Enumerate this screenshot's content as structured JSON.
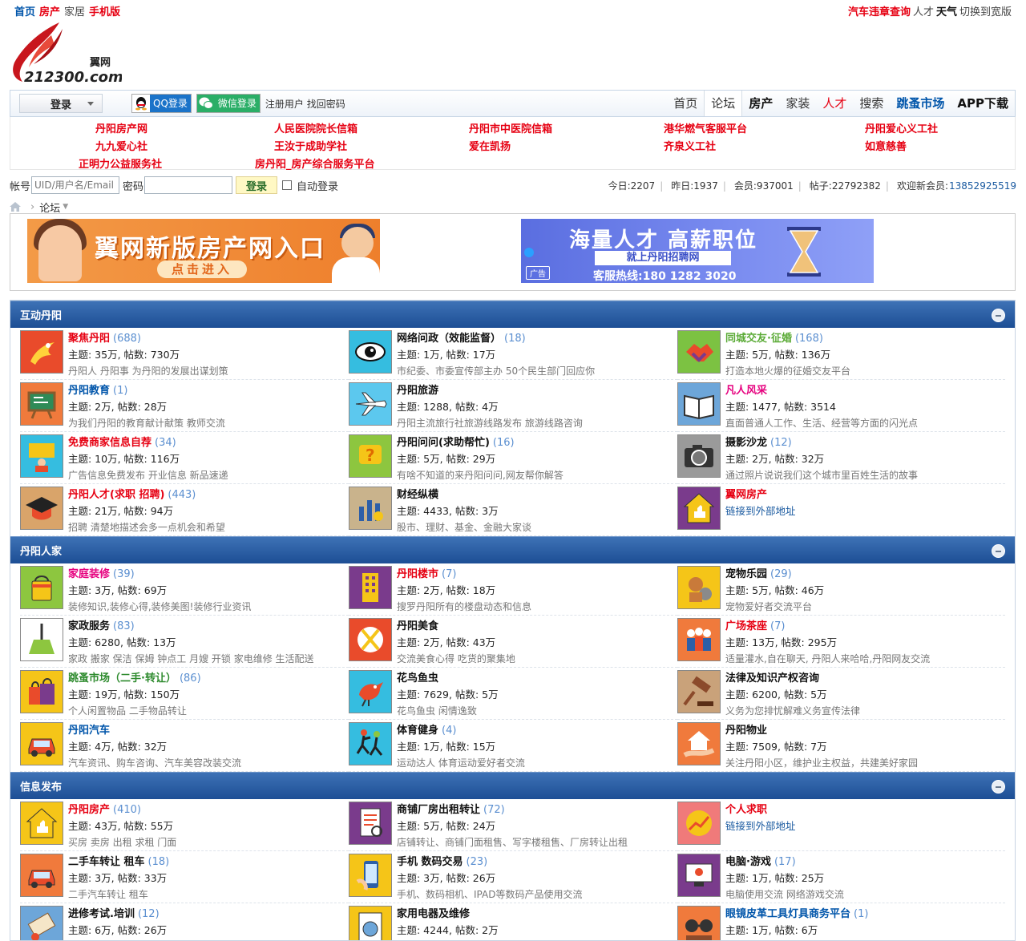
{
  "topbar": {
    "left": [
      {
        "label": "首页",
        "style": "blue"
      },
      {
        "label": "房产",
        "style": "red"
      },
      {
        "label": "家居",
        "style": "gray"
      },
      {
        "label": "手机版",
        "style": "red"
      }
    ],
    "right": [
      {
        "label": "汽车违章查询",
        "style": "red"
      },
      {
        "label": "人才",
        "style": "gray"
      },
      {
        "label": "天气",
        "style": "blk"
      },
      {
        "label": "切换到宽版",
        "style": "gray"
      }
    ]
  },
  "logo": {
    "cn": "翼网",
    "en": "212300.com"
  },
  "nav": {
    "login_label": "登录",
    "qq_label": "QQ登录",
    "wx_label": "微信登录",
    "register": "注册用户",
    "forgot": "找回密码",
    "items": [
      {
        "label": "首页",
        "style": ""
      },
      {
        "label": "论坛",
        "style": "act"
      },
      {
        "label": "房产",
        "style": "bk"
      },
      {
        "label": "家装",
        "style": ""
      },
      {
        "label": "人才",
        "style": "rd"
      },
      {
        "label": "搜索",
        "style": ""
      },
      {
        "label": "跳蚤市场",
        "style": "bl"
      },
      {
        "label": "APP下载",
        "style": "bk"
      }
    ]
  },
  "links": [
    "丹阳房产网",
    "人民医院院长信箱",
    "丹阳市中医院信箱",
    "港华燃气客服平台",
    "丹阳爱心义工社",
    "九九爱心社",
    "王汝于成助学社",
    "爱在凯扬",
    "齐泉义工社",
    "如意慈善",
    "正明力公益服务社",
    "房丹阳_房产综合服务平台"
  ],
  "login": {
    "account_label": "帐号",
    "account_placeholder": "UID/用户名/Email",
    "password_label": "密码",
    "submit": "登录",
    "auto": "自动登录"
  },
  "stats": {
    "today": "今日:2207",
    "yesterday": "昨日:1937",
    "members": "会员:937001",
    "posts": "帖子:22792382",
    "welcome": "欢迎新会员:",
    "newest": "13852925519"
  },
  "crumb": {
    "label": "论坛"
  },
  "banners": {
    "b1_title": "翼网新版房产网入口",
    "b1_btn": "点击进入",
    "b2_title": "海量人才 高薪职位",
    "b2_sub": "就上丹阳招聘网",
    "b2_phone": "客服热线:180 1282 3020",
    "b2_ad": "广告"
  },
  "categories": [
    {
      "name": "互动丹阳",
      "forums": [
        {
          "title": "聚焦丹阳",
          "count": "(688)",
          "style": "red",
          "stats": "主题: 35万, 帖数: 730万",
          "desc": "丹阳人 丹阳事 为丹阳的发展出谋划策",
          "icon": "phoenix-icon",
          "bg": "#e94b2b"
        },
        {
          "title": "网络问政（效能监督）",
          "count": "(18)",
          "style": "",
          "stats": "主题: 1万, 帖数: 17万",
          "desc": "市纪委、市委宣传部主办 50个民生部门回应你",
          "icon": "eye-icon",
          "bg": "#35bde0"
        },
        {
          "title": "同城交友·征婚",
          "count": "(168)",
          "style": "lgr",
          "stats": "主题: 5万, 帖数: 136万",
          "desc": "打造本地火爆的征婚交友平台",
          "icon": "handshake-icon",
          "bg": "#7cc242"
        },
        {
          "title": "丹阳教育",
          "count": "(1)",
          "style": "blu",
          "stats": "主题: 2万, 帖数: 28万",
          "desc": "为我们丹阳的教育献计献策 教师交流",
          "icon": "blackboard-icon",
          "bg": "#f07a3c"
        },
        {
          "title": "丹阳旅游",
          "count": "",
          "style": "",
          "stats": "主题: 1288, 帖数: 4万",
          "desc": "丹阳主流旅行社旅游线路发布 旅游线路咨询",
          "icon": "airplane-icon",
          "bg": "#5cc8ee"
        },
        {
          "title": "凡人风采",
          "count": "",
          "style": "pnk",
          "stats": "主题: 1477, 帖数: 3514",
          "desc": "直面普通人工作、生活、经营等方面的闪光点",
          "icon": "book-icon",
          "bg": "#6da6d9"
        },
        {
          "title": "免费商家信息自荐",
          "count": "(34)",
          "style": "red",
          "stats": "主题: 10万, 帖数: 116万",
          "desc": "广告信息免费发布 开业信息 新品速递",
          "icon": "presenter-icon",
          "bg": "#35bde0"
        },
        {
          "title": "丹阳问问(求助帮忙)",
          "count": "(16)",
          "style": "",
          "stats": "主题: 5万, 帖数: 29万",
          "desc": "有啥不知道的来丹阳问问,网友帮你解答",
          "icon": "question-icon",
          "bg": "#8dc63f"
        },
        {
          "title": "摄影沙龙",
          "count": "(12)",
          "style": "",
          "stats": "主题: 2万, 帖数: 32万",
          "desc": "通过照片说说我们这个城市里百姓生活的故事",
          "icon": "camera-icon",
          "bg": "#9a9a9a"
        },
        {
          "title": "丹阳人才(求职 招聘)",
          "count": "(443)",
          "style": "red",
          "stats": "主题: 21万, 帖数: 94万",
          "desc": "招聘 清楚地描述会多一点机会和希望",
          "icon": "graduation-cap-icon",
          "bg": "#d9a46a"
        },
        {
          "title": "财经纵横",
          "count": "",
          "style": "",
          "stats": "主题: 4433, 帖数: 3万",
          "desc": "股市、理财、基金、金融大家谈",
          "icon": "chart-icon",
          "bg": "#c9b38c"
        },
        {
          "title": "翼网房产",
          "count": "",
          "style": "red",
          "stats": "",
          "desc": "",
          "ext": "链接到外部地址",
          "icon": "house-like-icon",
          "bg": "#7a3b8c"
        }
      ]
    },
    {
      "name": "丹阳人家",
      "forums": [
        {
          "title": "家庭装修",
          "count": "(39)",
          "style": "pnk",
          "stats": "主题: 3万, 帖数: 69万",
          "desc": "装修知识,装修心得,装修美图!装修行业资讯",
          "icon": "paint-bucket-icon",
          "bg": "#8dc63f"
        },
        {
          "title": "丹阳楼市",
          "count": "(7)",
          "style": "red",
          "stats": "主题: 2万, 帖数: 18万",
          "desc": "搜罗丹阳所有的楼盘动态和信息",
          "icon": "building-icon",
          "bg": "#7a3b8c"
        },
        {
          "title": "宠物乐园",
          "count": "(29)",
          "style": "",
          "stats": "主题: 5万, 帖数: 46万",
          "desc": "宠物爱好者交流平台",
          "icon": "pet-icon",
          "bg": "#f5c518"
        },
        {
          "title": "家政服务",
          "count": "(83)",
          "style": "",
          "stats": "主题: 6280, 帖数: 13万",
          "desc": "家政 搬家 保洁 保姆 钟点工 月嫂 开锁 家电维修 生活配送",
          "icon": "broom-icon",
          "bg": "#ffffff"
        },
        {
          "title": "丹阳美食",
          "count": "",
          "style": "",
          "stats": "主题: 2万, 帖数: 43万",
          "desc": "交流美食心得 吃货的聚集地",
          "icon": "cutlery-icon",
          "bg": "#e94b2b"
        },
        {
          "title": "广场茶座",
          "count": "(7)",
          "style": "red",
          "stats": "主题: 13万, 帖数: 295万",
          "desc": "适量灌水,自在聊天, 丹阳人来哈哈,丹阳网友交流",
          "icon": "people-icon",
          "bg": "#f07a3c"
        },
        {
          "title": "跳蚤市场（二手·转让）",
          "count": "(86)",
          "style": "grn",
          "stats": "主题: 19万, 帖数: 150万",
          "desc": "个人闲置物品 二手物品转让",
          "icon": "shopping-bags-icon",
          "bg": "#f5c518"
        },
        {
          "title": "花鸟鱼虫",
          "count": "",
          "style": "",
          "stats": "主题: 7629, 帖数: 5万",
          "desc": "花鸟鱼虫    闲情逸致",
          "icon": "bird-icon",
          "bg": "#35bde0"
        },
        {
          "title": "法律及知识产权咨询",
          "count": "",
          "style": "",
          "stats": "主题: 6200, 帖数: 5万",
          "desc": "义务为您排忧解难义务宣传法律",
          "icon": "gavel-icon",
          "bg": "#c9a27a"
        },
        {
          "title": "丹阳汽车",
          "count": "",
          "style": "blu",
          "stats": "主题: 4万, 帖数: 32万",
          "desc": "汽车资讯、购车咨询、汽车美容改装交流",
          "icon": "car-icon",
          "bg": "#f5c518"
        },
        {
          "title": "体育健身",
          "count": "(4)",
          "style": "",
          "stats": "主题: 1万, 帖数: 15万",
          "desc": "运动达人 体育运动爱好者交流",
          "icon": "runners-icon",
          "bg": "#35bde0"
        },
        {
          "title": "丹阳物业",
          "count": "",
          "style": "",
          "stats": "主题: 7509, 帖数: 7万",
          "desc": "关注丹阳小区，维护业主权益，共建美好家园",
          "icon": "house-hand-icon",
          "bg": "#f07a3c"
        }
      ]
    },
    {
      "name": "信息发布",
      "forums": [
        {
          "title": "丹阳房产",
          "count": "(410)",
          "style": "red",
          "stats": "主题: 43万, 帖数: 55万",
          "desc": "买房 卖房 出租 求租 门面",
          "icon": "house-like-icon",
          "bg": "#f5c518"
        },
        {
          "title": "商铺厂房出租转让",
          "count": "(72)",
          "style": "",
          "stats": "主题: 5万, 帖数: 24万",
          "desc": "店铺转让、商铺门面租售、写字楼租售、厂房转让出租",
          "icon": "document-icon",
          "bg": "#7a3b8c"
        },
        {
          "title": "个人求职",
          "count": "",
          "style": "red",
          "stats": "",
          "desc": "",
          "ext": "链接到外部地址",
          "icon": "growth-icon",
          "bg": "#f07a7a"
        },
        {
          "title": "二手车转让 租车",
          "count": "(18)",
          "style": "",
          "stats": "主题: 3万, 帖数: 33万",
          "desc": "二手汽车转让 租车",
          "icon": "car-icon",
          "bg": "#f07a3c"
        },
        {
          "title": "手机 数码交易",
          "count": "(23)",
          "style": "",
          "stats": "主题: 3万, 帖数: 26万",
          "desc": "手机、数码相机、IPAD等数码产品使用交流",
          "icon": "phone-icon",
          "bg": "#f5c518"
        },
        {
          "title": "电脑·游戏",
          "count": "(17)",
          "style": "",
          "stats": "主题: 1万, 帖数: 25万",
          "desc": "电脑使用交流  网络游戏交流",
          "icon": "computer-icon",
          "bg": "#7a3b8c"
        },
        {
          "title": "进修考试.培训",
          "count": "(12)",
          "style": "",
          "stats": "主题: 6万, 帖数: 26万",
          "desc": "",
          "icon": "diploma-icon",
          "bg": "#6da6d9"
        },
        {
          "title": "家用电器及维修",
          "count": "",
          "style": "",
          "stats": "主题: 4244, 帖数: 2万",
          "desc": "",
          "icon": "washer-icon",
          "bg": "#f5c518"
        },
        {
          "title": "眼镜皮革工具灯具商务平台",
          "count": "(1)",
          "style": "blu",
          "stats": "主题: 1万, 帖数: 6万",
          "desc": "",
          "icon": "glasses-icon",
          "bg": "#f07a3c"
        }
      ]
    }
  ]
}
